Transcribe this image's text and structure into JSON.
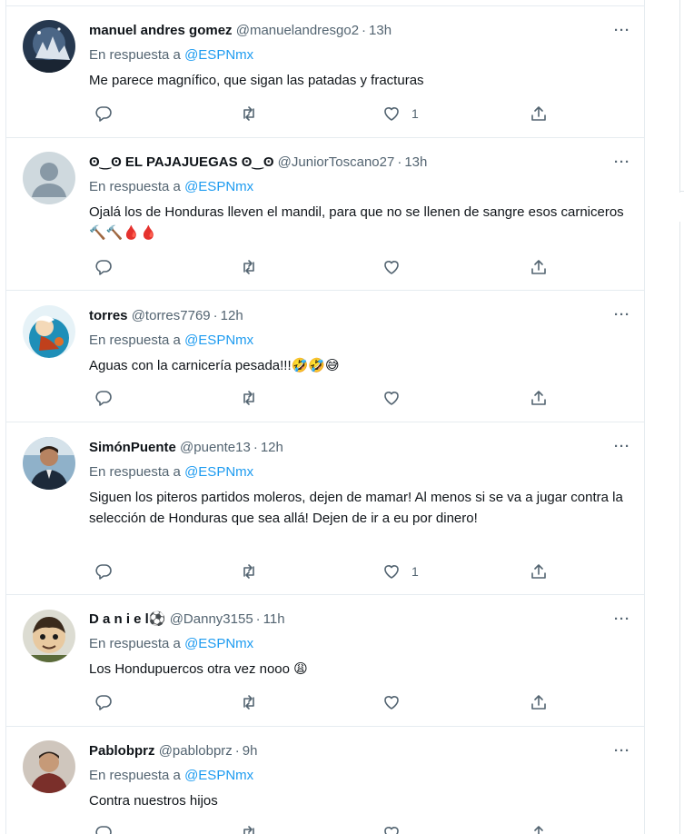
{
  "tweets": [
    {
      "name": "manuel andres gomez",
      "handle": "@manuelandresgo2",
      "time": "13h",
      "reply_prefix": "En respuesta a",
      "reply_to": "@ESPNmx",
      "text": "Me parece magnífico, que sigan las patadas y fracturas",
      "likes": "1",
      "avatar_icon": "night-sky-avatar"
    },
    {
      "name": "ʘ‿ʘ EL PAJAJUEGAS ʘ‿ʘ",
      "handle": "@JuniorToscano27",
      "time": "13h",
      "reply_prefix": "En respuesta a",
      "reply_to": "@ESPNmx",
      "text": "Ojalá los de Honduras lleven el mandil, para que no se llenen de sangre esos carniceros 🔨🔨🩸🩸",
      "likes": "",
      "avatar_icon": "default-profile-avatar"
    },
    {
      "name": "torres",
      "handle": "@torres7769",
      "time": "12h",
      "reply_prefix": "En respuesta a",
      "reply_to": "@ESPNmx",
      "text": "Aguas con la carnicería pesada!!!🤣🤣😅",
      "likes": "",
      "avatar_icon": "cartoon-avatar"
    },
    {
      "name": "SimónPuente",
      "handle": "@puente13",
      "time": "12h",
      "reply_prefix": "En respuesta a",
      "reply_to": "@ESPNmx",
      "text": "Siguen los piteros partidos moleros, dejen de mamar! Al menos si se va a jugar contra la selección de Honduras que sea allá! Dejen de ir a eu por dinero!",
      "likes": "1",
      "avatar_icon": "person-photo-avatar"
    },
    {
      "name": "D a n i e l⚽",
      "handle": "@Danny3155",
      "time": "11h",
      "reply_prefix": "En respuesta a",
      "reply_to": "@ESPNmx",
      "text": "Los Hondupuercos otra vez nooo 😩",
      "likes": "",
      "avatar_icon": "cartoon-face-avatar"
    },
    {
      "name": "Pablobprz",
      "handle": "@pablobprz",
      "time": "9h",
      "reply_prefix": "En respuesta a",
      "reply_to": "@ESPNmx",
      "text": "Contra nuestros hijos",
      "likes": "",
      "avatar_icon": "person-photo-avatar"
    }
  ],
  "more_label": "···",
  "colors": {
    "link": "#1d9bf0",
    "secondary_text": "#536471",
    "border": "#e6ecf0"
  }
}
